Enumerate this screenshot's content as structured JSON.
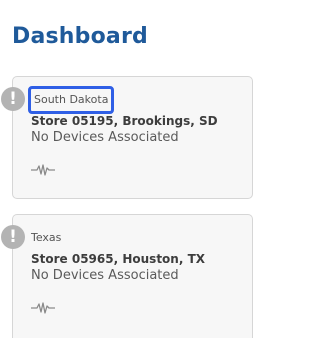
{
  "header": {
    "title": "Dashboard"
  },
  "stores": [
    {
      "state": "South Dakota",
      "name": "Store 05195, Brookings, SD",
      "status": "No Devices Associated",
      "alert_icon": "exclamation-circle-icon",
      "activity_icon": "pulse-icon"
    },
    {
      "state": "Texas",
      "name": "Store 05965, Houston, TX",
      "status": "No Devices Associated",
      "alert_icon": "exclamation-circle-icon",
      "activity_icon": "pulse-icon"
    }
  ],
  "colors": {
    "title": "#1f5a9a",
    "highlight_border": "#2f5fe6",
    "alert_icon": "#b3b3b3",
    "card_background": "#f7f7f7"
  }
}
